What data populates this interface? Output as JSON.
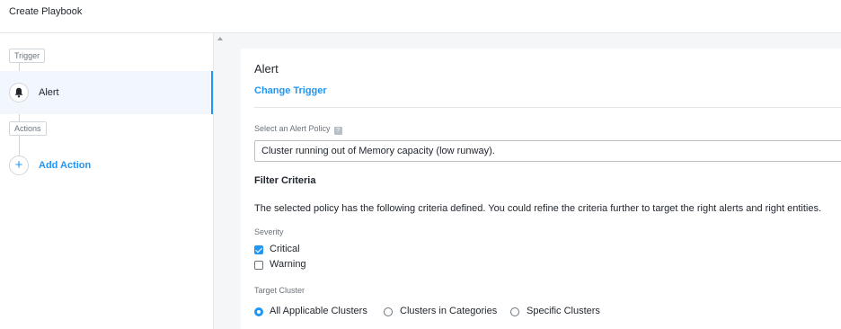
{
  "header": {
    "title": "Create Playbook"
  },
  "sidebar": {
    "trigger_tag": "Trigger",
    "trigger_step": {
      "label": "Alert",
      "icon": "bell-icon"
    },
    "actions_tag": "Actions",
    "add_action": {
      "label": "Add Action",
      "icon": "plus-icon"
    }
  },
  "panel": {
    "heading": "Alert",
    "change_trigger": "Change Trigger",
    "policy_label": "Select an Alert Policy",
    "policy_help_icon": "question-icon",
    "policy_value": "Cluster running out of Memory capacity (low runway).",
    "filter_heading": "Filter Criteria",
    "filter_description": "The selected policy has the following criteria defined. You could refine the criteria further to target the right alerts and right entities.",
    "severity_label": "Severity",
    "severity_options": [
      {
        "label": "Critical",
        "checked": true
      },
      {
        "label": "Warning",
        "checked": false
      }
    ],
    "target_label": "Target Cluster",
    "target_options": [
      {
        "label": "All Applicable Clusters",
        "selected": true
      },
      {
        "label": "Clusters in Categories",
        "selected": false
      },
      {
        "label": "Specific Clusters",
        "selected": false
      }
    ]
  },
  "colors": {
    "accent": "#2196f3",
    "active_bg": "#f1f7fc",
    "canvas_bg": "#f4f6f7"
  }
}
